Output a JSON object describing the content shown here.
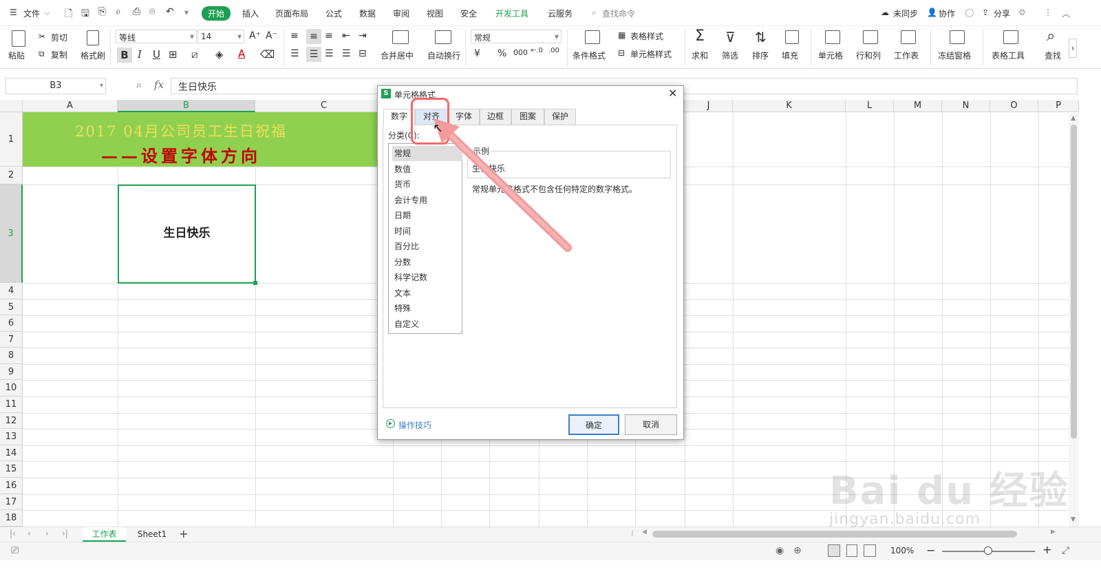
{
  "menubar": {
    "file": "文件",
    "tabs": [
      "开始",
      "插入",
      "页面布局",
      "公式",
      "数据",
      "审阅",
      "视图",
      "安全",
      "开发工具",
      "云服务"
    ],
    "search": "查找命令",
    "right": [
      "未同步",
      "协作",
      "分享"
    ]
  },
  "ribbon": {
    "paste": "粘贴",
    "cut": "剪切",
    "copy": "复制",
    "format_painter": "格式刷",
    "font_name": "等线",
    "font_size": "14",
    "merge_center": "合并居中",
    "wrap_text": "自动换行",
    "number_format": "常规",
    "conditional_format": "条件格式",
    "table_style": "表格样式",
    "cell_style": "单元格样式",
    "sum": "求和",
    "filter": "筛选",
    "sort": "排序",
    "fill": "填充",
    "cell": "单元格",
    "row_col": "行和列",
    "worksheet": "工作表",
    "freeze": "冻结窗格",
    "table_tools": "表格工具",
    "find": "查找"
  },
  "formula_bar": {
    "cell_ref": "B3",
    "fx": "fx",
    "content": "生日快乐"
  },
  "sheet": {
    "columns": [
      "A",
      "B",
      "C",
      "J",
      "K",
      "L",
      "M",
      "N",
      "O",
      "P"
    ],
    "rows": [
      "1",
      "2",
      "3",
      "4",
      "5",
      "6",
      "7",
      "8",
      "9",
      "10",
      "11",
      "12",
      "13",
      "14",
      "15",
      "16",
      "17",
      "18"
    ],
    "title_line1": "2017 04月公司员工生日祝福",
    "title_line2": "——设置字体方向",
    "b3": "生日快乐"
  },
  "dialog": {
    "title": "单元格格式",
    "tabs": [
      "数字",
      "对齐",
      "字体",
      "边框",
      "图案",
      "保护"
    ],
    "category_label": "分类(C):",
    "categories": [
      "常规",
      "数值",
      "货币",
      "会计专用",
      "日期",
      "时间",
      "百分比",
      "分数",
      "科学记数",
      "文本",
      "特殊",
      "自定义"
    ],
    "sample_label": "示例",
    "sample_value": "生日快乐",
    "description": "常规单元格格式不包含任何特定的数字格式。",
    "tips": "操作技巧",
    "ok": "确定",
    "cancel": "取消"
  },
  "sheet_tabs": [
    "工作表",
    "Sheet1"
  ],
  "status": {
    "zoom": "100%"
  },
  "watermark": {
    "text": "Bai du 经验",
    "url": "jingyan.baidu.com"
  },
  "colors": {
    "accent": "#1f9f53",
    "title_bg": "#8fd14f",
    "title1": "#f2dc5d",
    "title2": "#c00000",
    "highlight": "#f06a6a"
  }
}
